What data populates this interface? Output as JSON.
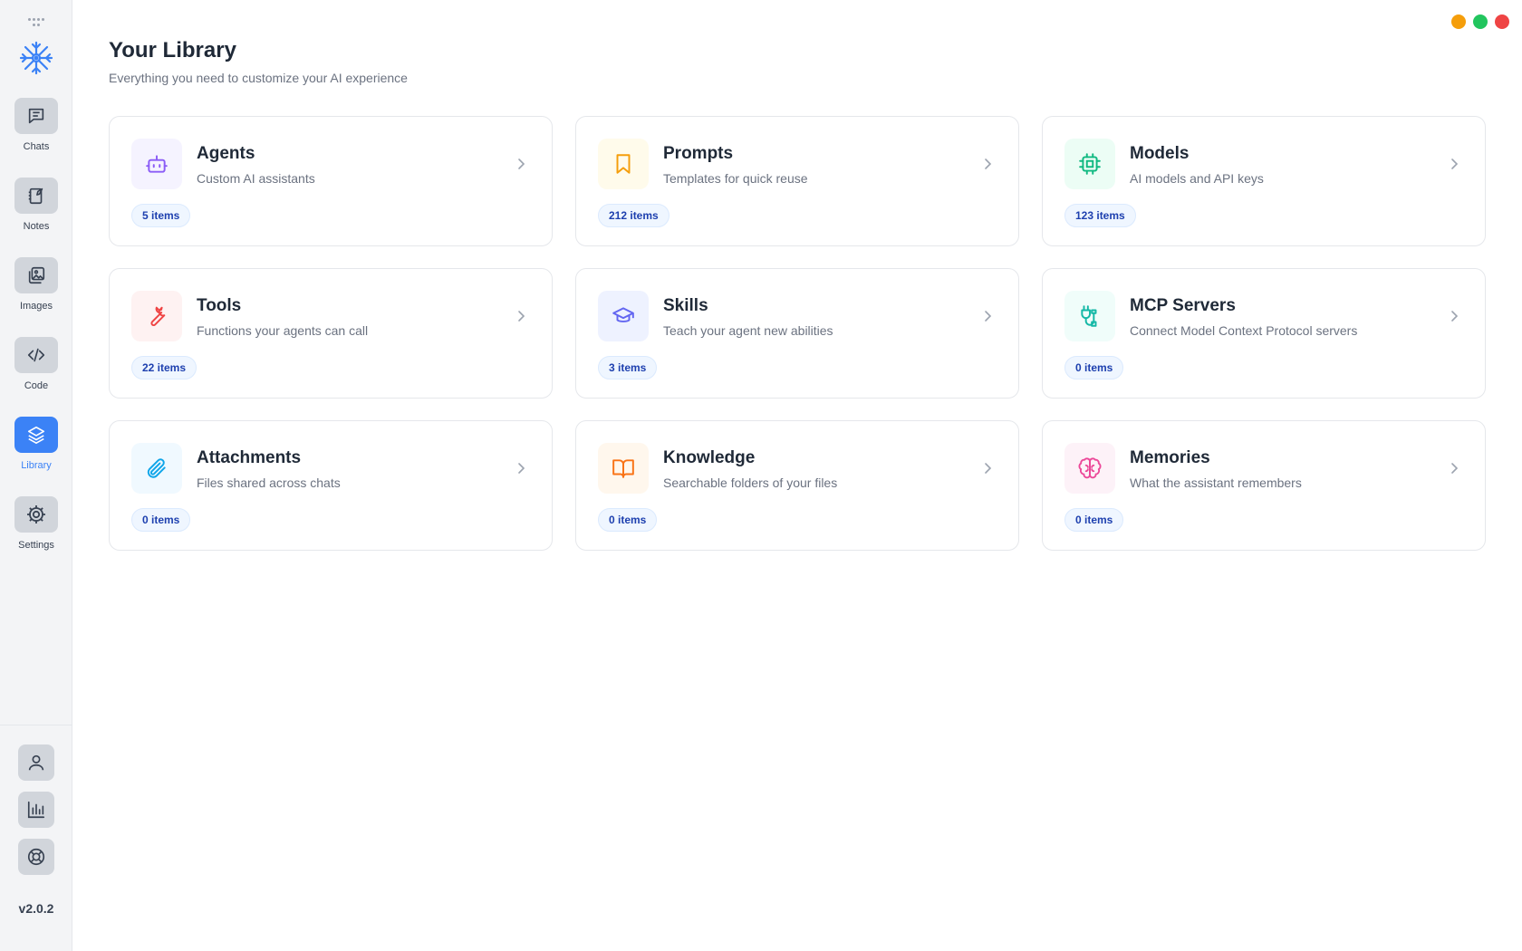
{
  "sidebar": {
    "nav": [
      {
        "label": "Chats",
        "icon": "chat-icon",
        "active": false
      },
      {
        "label": "Notes",
        "icon": "notes-icon",
        "active": false
      },
      {
        "label": "Images",
        "icon": "images-icon",
        "active": false
      },
      {
        "label": "Code",
        "icon": "code-icon",
        "active": false
      },
      {
        "label": "Library",
        "icon": "layers-icon",
        "active": true
      },
      {
        "label": "Settings",
        "icon": "gear-icon",
        "active": false
      }
    ],
    "utilities": [
      "user-icon",
      "bar-chart-icon",
      "lifebuoy-icon"
    ],
    "version": "v2.0.2"
  },
  "window_controls": {
    "minimize_color": "#f59e0b",
    "maximize_color": "#22c55e",
    "close_color": "#ef4444"
  },
  "header": {
    "title": "Your Library",
    "subtitle": "Everything you need to customize your AI experience"
  },
  "cards": [
    {
      "title": "Agents",
      "description": "Custom AI assistants",
      "count": "5 items",
      "icon": "bot-icon",
      "color": "#8b5cf6",
      "bg": "#f5f3ff"
    },
    {
      "title": "Prompts",
      "description": "Templates for quick reuse",
      "count": "212 items",
      "icon": "bookmark-icon",
      "color": "#f59e0b",
      "bg": "#fffbeb"
    },
    {
      "title": "Models",
      "description": "AI models and API keys",
      "count": "123 items",
      "icon": "cpu-icon",
      "color": "#10b981",
      "bg": "#ecfdf5"
    },
    {
      "title": "Tools",
      "description": "Functions your agents can call",
      "count": "22 items",
      "icon": "wrench-icon",
      "color": "#ef4444",
      "bg": "#fef2f2"
    },
    {
      "title": "Skills",
      "description": "Teach your agent new abilities",
      "count": "3 items",
      "icon": "graduation-cap-icon",
      "color": "#6366f1",
      "bg": "#eef2ff"
    },
    {
      "title": "MCP Servers",
      "description": "Connect Model Context Protocol servers",
      "count": "0 items",
      "icon": "plug-icon",
      "color": "#14b8a6",
      "bg": "#f0fdfa"
    },
    {
      "title": "Attachments",
      "description": "Files shared across chats",
      "count": "0 items",
      "icon": "paperclip-icon",
      "color": "#0ea5e9",
      "bg": "#f0f9ff"
    },
    {
      "title": "Knowledge",
      "description": "Searchable folders of your files",
      "count": "0 items",
      "icon": "book-open-icon",
      "color": "#f97316",
      "bg": "#fff7ed"
    },
    {
      "title": "Memories",
      "description": "What the assistant remembers",
      "count": "0 items",
      "icon": "brain-icon",
      "color": "#ec4899",
      "bg": "#fdf2f8"
    }
  ]
}
